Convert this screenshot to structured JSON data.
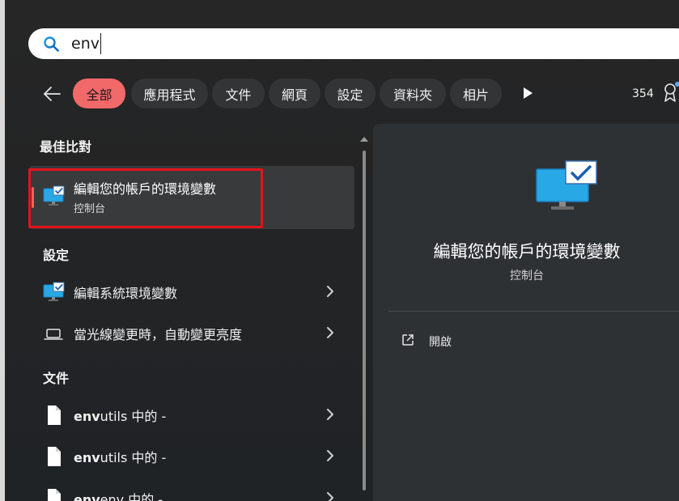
{
  "search": {
    "query": "env"
  },
  "filters": {
    "tabs": [
      {
        "label": "全部",
        "active": true
      },
      {
        "label": "應用程式",
        "active": false
      },
      {
        "label": "文件",
        "active": false
      },
      {
        "label": "網頁",
        "active": false
      },
      {
        "label": "設定",
        "active": false
      },
      {
        "label": "資料夾",
        "active": false
      },
      {
        "label": "相片",
        "active": false
      }
    ],
    "points": "354"
  },
  "results": {
    "best_match_heading": "最佳比對",
    "best_match": {
      "title": "編輯您的帳戶的環境變數",
      "subtitle": "控制台"
    },
    "settings_heading": "設定",
    "settings": [
      {
        "label": "編輯系統環境變數",
        "icon": "control-panel-monitor-icon"
      },
      {
        "label": "當光線變更時，自動變更亮度",
        "icon": "laptop-icon"
      }
    ],
    "documents_heading": "文件",
    "documents": [
      {
        "name_bold": "env",
        "name_rest": "utils 中的 -",
        "icon": "document-icon"
      },
      {
        "name_bold": "env",
        "name_rest": "utils 中的 -",
        "icon": "document-icon"
      },
      {
        "name_bold": "env",
        "name_rest": "env 中的 -",
        "icon": "document-icon"
      }
    ]
  },
  "preview": {
    "title": "編輯您的帳戶的環境變數",
    "subtitle": "控制台",
    "open_label": "開啟"
  },
  "colors": {
    "accent": "#f2696a",
    "highlight_box": "#e3141b",
    "panel": "#2e3134"
  }
}
